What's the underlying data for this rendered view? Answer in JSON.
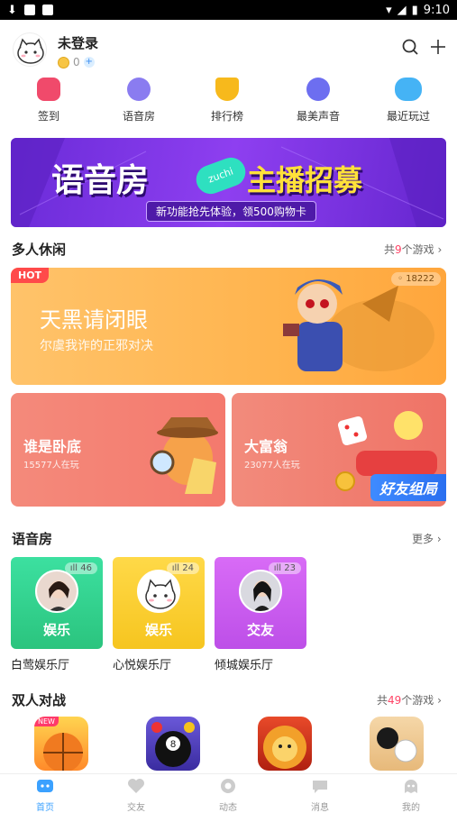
{
  "status": {
    "time": "9:10"
  },
  "header": {
    "username": "未登录",
    "coins": "0"
  },
  "quicknav": [
    {
      "label": "签到",
      "icon": "calendar-icon"
    },
    {
      "label": "语音房",
      "icon": "voice-room-icon"
    },
    {
      "label": "排行榜",
      "icon": "trophy-icon"
    },
    {
      "label": "最美声音",
      "icon": "music-note-icon"
    },
    {
      "label": "最近玩过",
      "icon": "gamepad-icon"
    }
  ],
  "banner": {
    "title_left": "语音房",
    "title_right": "主播招募",
    "brand": "zuchi",
    "subtitle": "新功能抢先体验，领500购物卡"
  },
  "section_casual": {
    "title": "多人休闲",
    "more_prefix": "共",
    "more_count": "9",
    "more_suffix": "个游戏"
  },
  "feature_game": {
    "badge": "HOT",
    "title": "天黑请闭眼",
    "subtitle": "尔虞我诈的正邪对决",
    "online": "18222"
  },
  "game_cards": [
    {
      "title": "谁是卧底",
      "sub": "15577人在玩"
    },
    {
      "title": "大富翁",
      "sub": "23077人在玩",
      "ribbon": "好友组局"
    }
  ],
  "section_voice": {
    "title": "语音房",
    "more": "更多"
  },
  "voice_rooms": [
    {
      "tag": "娱乐",
      "count": "46",
      "name": "白莺娱乐厅",
      "color": "#2fd18a"
    },
    {
      "tag": "娱乐",
      "count": "24",
      "name": "心悦娱乐厅",
      "color": "#f8c829"
    },
    {
      "tag": "交友",
      "count": "23",
      "name": "倾城娱乐厅",
      "color": "#c259f0"
    }
  ],
  "section_duel": {
    "title": "双人对战",
    "more_prefix": "共",
    "more_count": "49",
    "more_suffix": "个游戏"
  },
  "duel_games": [
    {
      "icon": "basketball-icon",
      "badge": "NEW"
    },
    {
      "icon": "billiards-icon",
      "badge": ""
    },
    {
      "icon": "lion-icon",
      "badge": ""
    },
    {
      "icon": "go-game-icon",
      "badge": ""
    }
  ],
  "tabs": [
    {
      "label": "首页",
      "icon": "home-tab-icon",
      "active": true
    },
    {
      "label": "交友",
      "icon": "heart-tab-icon",
      "active": false
    },
    {
      "label": "动态",
      "icon": "moments-tab-icon",
      "active": false
    },
    {
      "label": "消息",
      "icon": "message-tab-icon",
      "active": false
    },
    {
      "label": "我的",
      "icon": "profile-tab-icon",
      "active": false
    }
  ]
}
